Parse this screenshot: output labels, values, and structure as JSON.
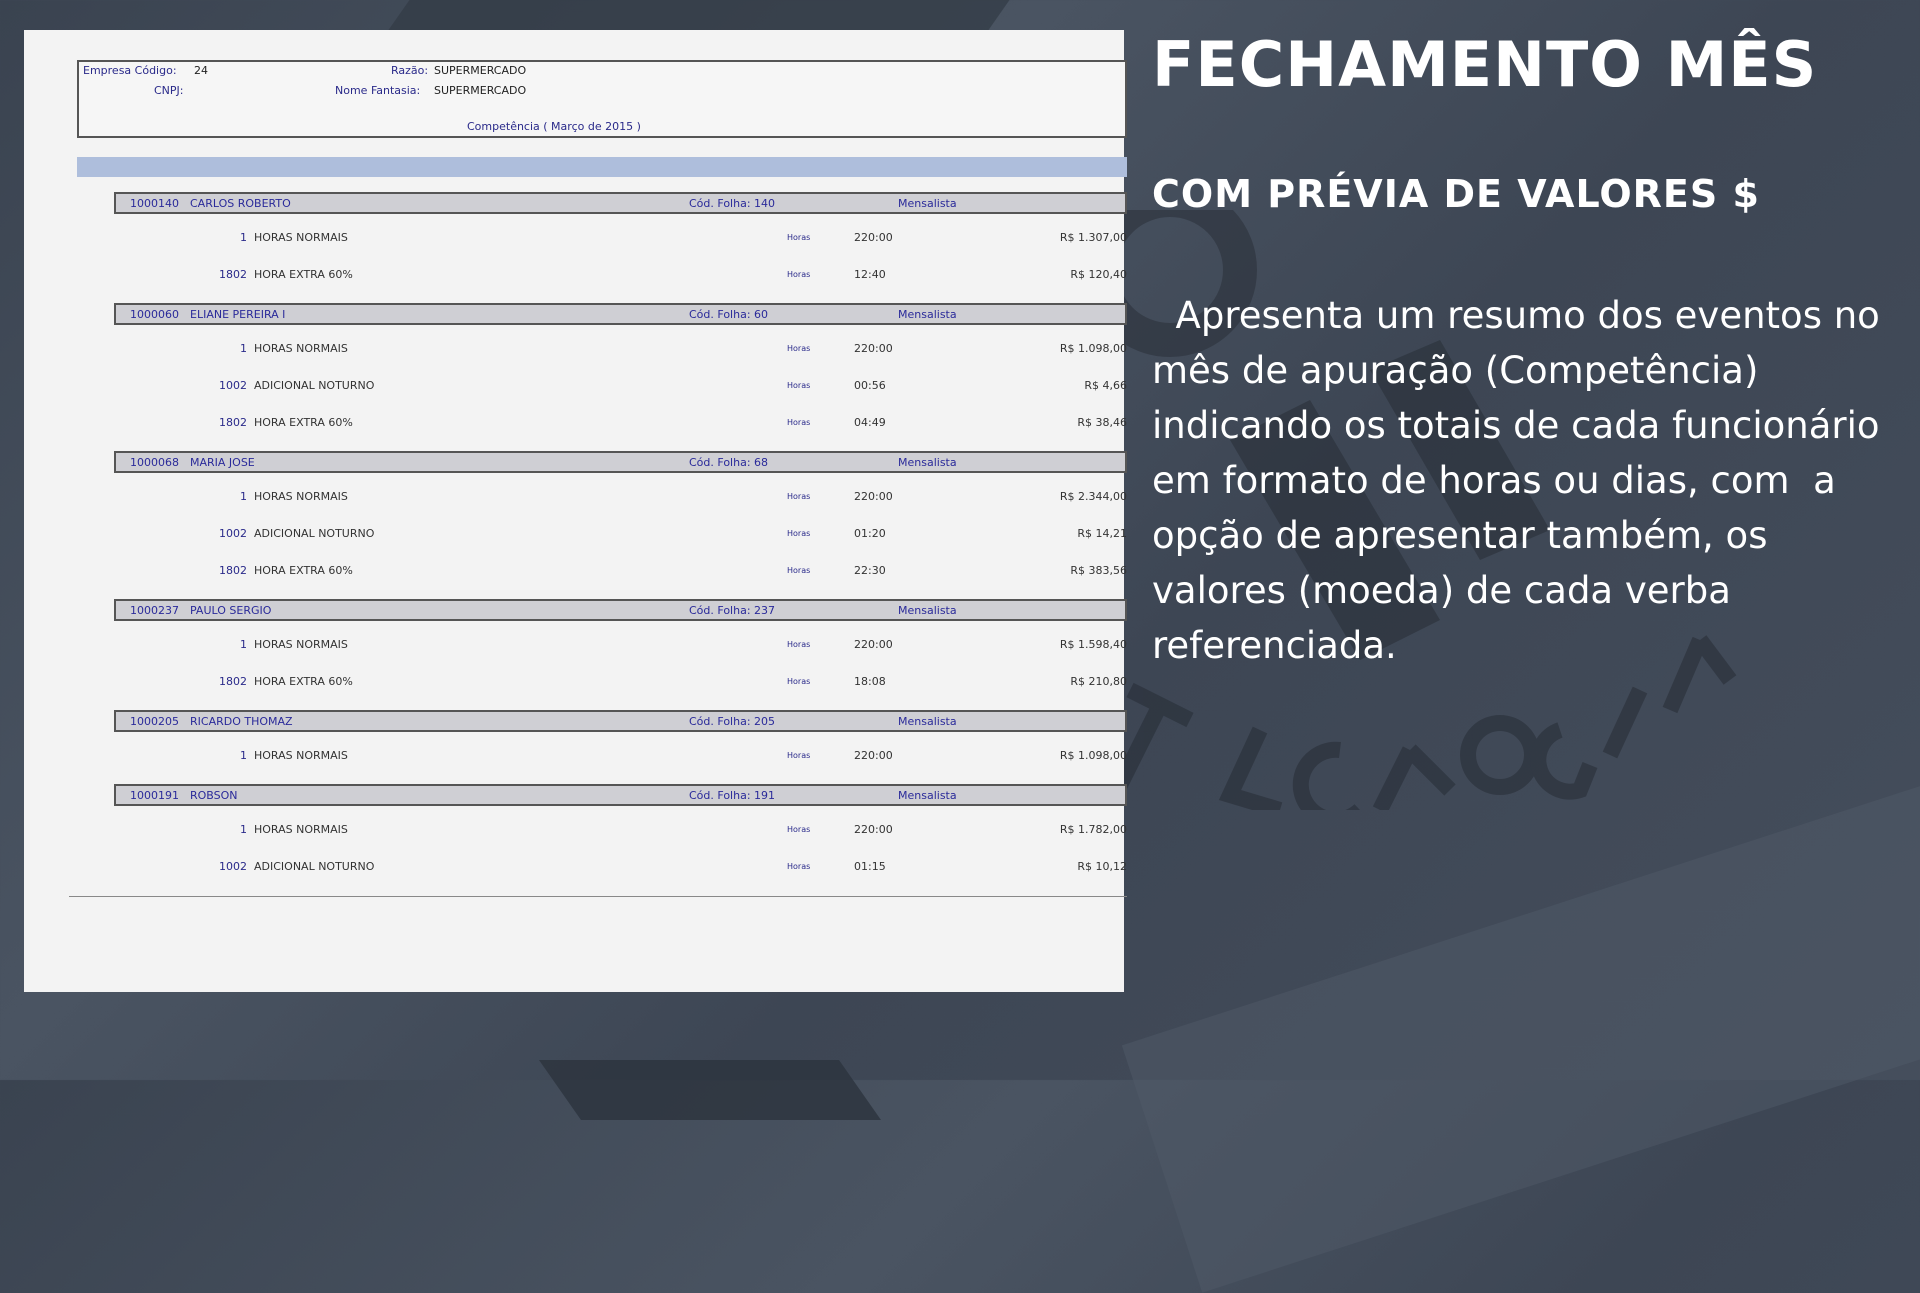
{
  "report": {
    "empresa_label": "Empresa Código:",
    "empresa_codigo": "24",
    "razao_label": "Razão:",
    "razao": "SUPERMERCADO",
    "cnpj_label": "CNPJ:",
    "nome_fantasia_label": "Nome Fantasia:",
    "nome_fantasia": "SUPERMERCADO",
    "competencia": "Competência ( Março de 2015 )"
  },
  "employees": [
    {
      "id": "1000140",
      "name": "CARLOS ROBERTO",
      "folha": "Cód. Folha: 140",
      "tipo": "Mensalista",
      "events": [
        {
          "code": "1",
          "desc": "HORAS NORMAIS",
          "unit": "Horas",
          "qty": "220:00",
          "amount": "R$ 1.307,00"
        },
        {
          "code": "1802",
          "desc": "HORA EXTRA 60%",
          "unit": "Horas",
          "qty": "12:40",
          "amount": "R$ 120,40"
        }
      ]
    },
    {
      "id": "1000060",
      "name": "ELIANE PEREIRA I",
      "folha": "Cód. Folha: 60",
      "tipo": "Mensalista",
      "events": [
        {
          "code": "1",
          "desc": "HORAS NORMAIS",
          "unit": "Horas",
          "qty": "220:00",
          "amount": "R$ 1.098,00"
        },
        {
          "code": "1002",
          "desc": "ADICIONAL NOTURNO",
          "unit": "Horas",
          "qty": "00:56",
          "amount": "R$ 4,66"
        },
        {
          "code": "1802",
          "desc": "HORA EXTRA 60%",
          "unit": "Horas",
          "qty": "04:49",
          "amount": "R$ 38,46"
        }
      ]
    },
    {
      "id": "1000068",
      "name": "MARIA JOSE",
      "folha": "Cód. Folha: 68",
      "tipo": "Mensalista",
      "events": [
        {
          "code": "1",
          "desc": "HORAS NORMAIS",
          "unit": "Horas",
          "qty": "220:00",
          "amount": "R$ 2.344,00"
        },
        {
          "code": "1002",
          "desc": "ADICIONAL NOTURNO",
          "unit": "Horas",
          "qty": "01:20",
          "amount": "R$ 14,21"
        },
        {
          "code": "1802",
          "desc": "HORA EXTRA 60%",
          "unit": "Horas",
          "qty": "22:30",
          "amount": "R$ 383,56"
        }
      ]
    },
    {
      "id": "1000237",
      "name": "PAULO SERGIO",
      "folha": "Cód. Folha: 237",
      "tipo": "Mensalista",
      "events": [
        {
          "code": "1",
          "desc": "HORAS NORMAIS",
          "unit": "Horas",
          "qty": "220:00",
          "amount": "R$ 1.598,40"
        },
        {
          "code": "1802",
          "desc": "HORA EXTRA 60%",
          "unit": "Horas",
          "qty": "18:08",
          "amount": "R$ 210,80"
        }
      ]
    },
    {
      "id": "1000205",
      "name": "RICARDO THOMAZ",
      "folha": "Cód. Folha: 205",
      "tipo": "Mensalista",
      "events": [
        {
          "code": "1",
          "desc": "HORAS NORMAIS",
          "unit": "Horas",
          "qty": "220:00",
          "amount": "R$ 1.098,00"
        }
      ]
    },
    {
      "id": "1000191",
      "name": "ROBSON",
      "folha": "Cód. Folha: 191",
      "tipo": "Mensalista",
      "events": [
        {
          "code": "1",
          "desc": "HORAS NORMAIS",
          "unit": "Horas",
          "qty": "220:00",
          "amount": "R$ 1.782,00"
        },
        {
          "code": "1002",
          "desc": "ADICIONAL NOTURNO",
          "unit": "Horas",
          "qty": "01:15",
          "amount": "R$ 10,12"
        }
      ]
    }
  ],
  "panel": {
    "title": "FECHAMENTO MÊS",
    "subtitle": "COM PRÉVIA DE VALORES $",
    "description": "  Apresenta um resumo dos eventos no mês de apuração (Competência) indicando os totais de cada funcionário em formato de horas ou dias, com  a opção de apresentar também, os valores (moeda) de cada verba referenciada."
  }
}
